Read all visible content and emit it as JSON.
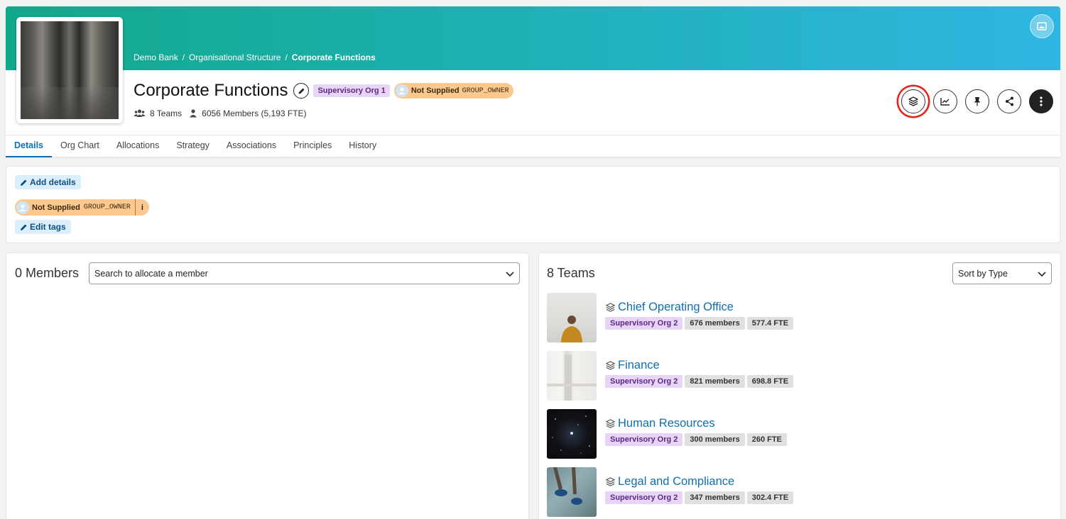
{
  "breadcrumb": {
    "items": [
      "Demo Bank",
      "Organisational Structure"
    ],
    "current": "Corporate Functions",
    "separator": "/"
  },
  "header": {
    "title": "Corporate Functions",
    "org_tag": "Supervisory Org 1",
    "owner_name": "Not Supplied",
    "owner_role": "GROUP_OWNER",
    "teams_count": "8 Teams",
    "members_count": "6056 Members (5,193 FTE)"
  },
  "tabs": [
    {
      "label": "Details"
    },
    {
      "label": "Org Chart"
    },
    {
      "label": "Allocations"
    },
    {
      "label": "Strategy"
    },
    {
      "label": "Associations"
    },
    {
      "label": "Principles"
    },
    {
      "label": "History"
    }
  ],
  "details": {
    "add_details_label": "Add details",
    "owner_name": "Not Supplied",
    "owner_role": "GROUP_OWNER",
    "info_label": "i",
    "edit_tags_label": "Edit tags"
  },
  "members_panel": {
    "title": "0 Members",
    "search_placeholder": "Search to allocate a member"
  },
  "teams_panel": {
    "title": "8 Teams",
    "sort_label": "Sort by Type",
    "teams": [
      {
        "name": "Chief Operating Office",
        "org": "Supervisory Org 2",
        "members": "676 members",
        "fte": "577.4 FTE"
      },
      {
        "name": "Finance",
        "org": "Supervisory Org 2",
        "members": "821 members",
        "fte": "698.8 FTE"
      },
      {
        "name": "Human Resources",
        "org": "Supervisory Org 2",
        "members": "300 members",
        "fte": "260 FTE"
      },
      {
        "name": "Legal and Compliance",
        "org": "Supervisory Org 2",
        "members": "347 members",
        "fte": "302.4 FTE"
      }
    ]
  },
  "colors": {
    "accent": "#0f6fb1",
    "banner_start": "#12a88a",
    "banner_end": "#2eb6e2",
    "highlight_ring": "#e8201a",
    "owner_pill": "#fcc88d",
    "org_tag": "#e8d4f6"
  },
  "icons": {
    "banner_button": "image-icon",
    "edit": "pencil-icon",
    "teams": "users-icon",
    "members": "user-icon",
    "actions": [
      "layers-icon",
      "chart-line-icon",
      "pin-icon",
      "share-icon",
      "more-vertical-icon"
    ]
  }
}
